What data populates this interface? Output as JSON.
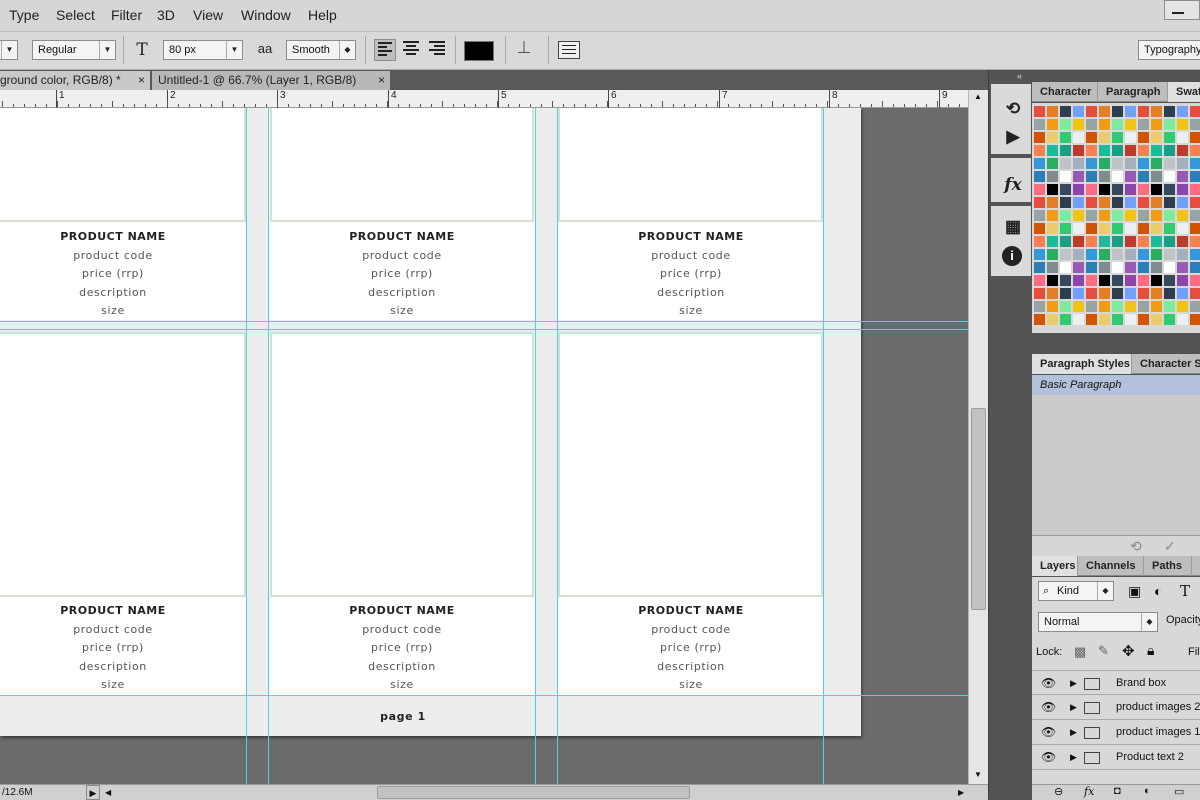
{
  "menu": [
    "Type",
    "Select",
    "Filter",
    "3D",
    "View",
    "Window",
    "Help"
  ],
  "options": {
    "font_style": "Regular",
    "font_size": "80 px",
    "antialias_icon": "aa",
    "antialias": "Smooth",
    "workspace": "Typography",
    "text_color": "#000000"
  },
  "tabs": [
    {
      "label": "ground color, RGB/8) *",
      "close": "×"
    },
    {
      "label": "Untitled-1 @ 66.7% (Layer 1, RGB/8)",
      "close": "×"
    }
  ],
  "ruler": [
    "1",
    "2",
    "3",
    "4",
    "5",
    "6",
    "7",
    "8",
    "9"
  ],
  "products": {
    "name": "PRODUCT NAME",
    "code": "product code",
    "price": "price (rrp)",
    "description": "description",
    "size": "size"
  },
  "page_label": "page 1",
  "status": {
    "doc_size": "/12.6M",
    "arrow": "▶"
  },
  "panels": {
    "top_tabs": [
      "Character",
      "Paragraph",
      "Swatches"
    ],
    "style_tabs": [
      "Paragraph Styles",
      "Character Styles"
    ],
    "basic_paragraph": "Basic Paragraph",
    "layer_tabs": [
      "Layers",
      "Channels",
      "Paths"
    ],
    "kind_filter": "Kind",
    "blend_mode": "Normal",
    "opacity_label": "Opacity:",
    "lock_label": "Lock:",
    "fill_label": "Fill:",
    "layers": [
      "Brand box",
      "product images 2",
      "product images 1",
      "Product text 2"
    ],
    "swatch_colors": [
      "#e74c3c",
      "#f1c40f",
      "#2ecc71",
      "#1abc9c",
      "#3498db",
      "#9b59b6",
      "#34495e",
      "#e67e22",
      "#95a5a6",
      "#ecf0f1",
      "#16a085",
      "#27ae60",
      "#2980b9",
      "#8e44ad",
      "#2c3e50",
      "#f39c12",
      "#d35400",
      "#c0392b",
      "#bdc3c7",
      "#7f8c8d",
      "#ff6b81",
      "#70a1ff",
      "#7bed9f",
      "#eccc68",
      "#ff7f50",
      "#a4b0be",
      "#ffffff",
      "#000000"
    ]
  }
}
